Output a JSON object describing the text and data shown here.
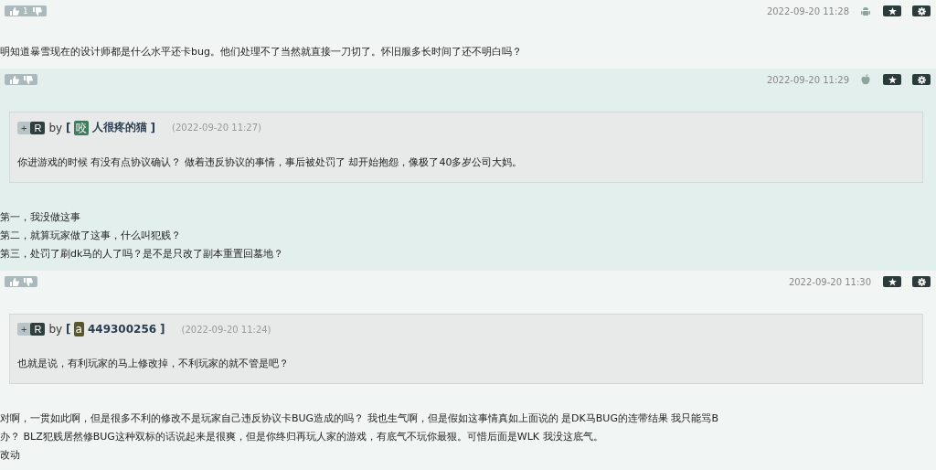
{
  "posts": [
    {
      "vote_count": "1",
      "time": "2022-09-20 11:28",
      "device": {
        "kind": "android"
      },
      "body": [
        "明知道暴雪现在的设计师都是什么水平还卡bug。他们处理不了当然就直接一刀切了。怀旧服多长时间了还不明白吗？"
      ]
    },
    {
      "time": "2022-09-20 11:29",
      "device": {
        "kind": "apple"
      },
      "quote": {
        "plus": "+",
        "reply": "R",
        "by": "by",
        "open": "[",
        "initial": "咬",
        "color": "#3f7b5f",
        "author": "人很疼的猫",
        "close": "]",
        "time": "(2022-09-20 11:27)",
        "text": "你进游戏的时候 有没有点协议确认？ 做着违反协议的事情，事后被处罚了 却开始抱怨，像极了40多岁公司大妈。"
      },
      "body": [
        "第一，我没做这事",
        "第二，就算玩家做了这事，什么叫犯贱？",
        "第三，处罚了刷dk马的人了吗？是不是只改了副本重置回墓地？"
      ]
    },
    {
      "time": "2022-09-20 11:30",
      "quote": {
        "plus": "+",
        "reply": "R",
        "by": "by",
        "open": "[",
        "initial": "a",
        "color": "#58562e",
        "author": "449300256",
        "close": "]",
        "time": "(2022-09-20 11:24)",
        "text": "也就是说，有利玩家的马上修改掉，不利玩家的就不管是吧？"
      },
      "body": [
        "对啊，一贯如此啊，但是很多不利的修改不是玩家自己违反协议卡BUG造成的吗？ 我也生气啊，但是假如这事情真如上面说的 是DK马BUG的连带结果 我只能骂B",
        "办？ BLZ犯贱居然修BUG这种双标的话说起来是很爽，但是你终归再玩人家的游戏，有底气不玩你最狠。可惜后面是WLK 我没这底气。",
        "改动"
      ]
    }
  ]
}
